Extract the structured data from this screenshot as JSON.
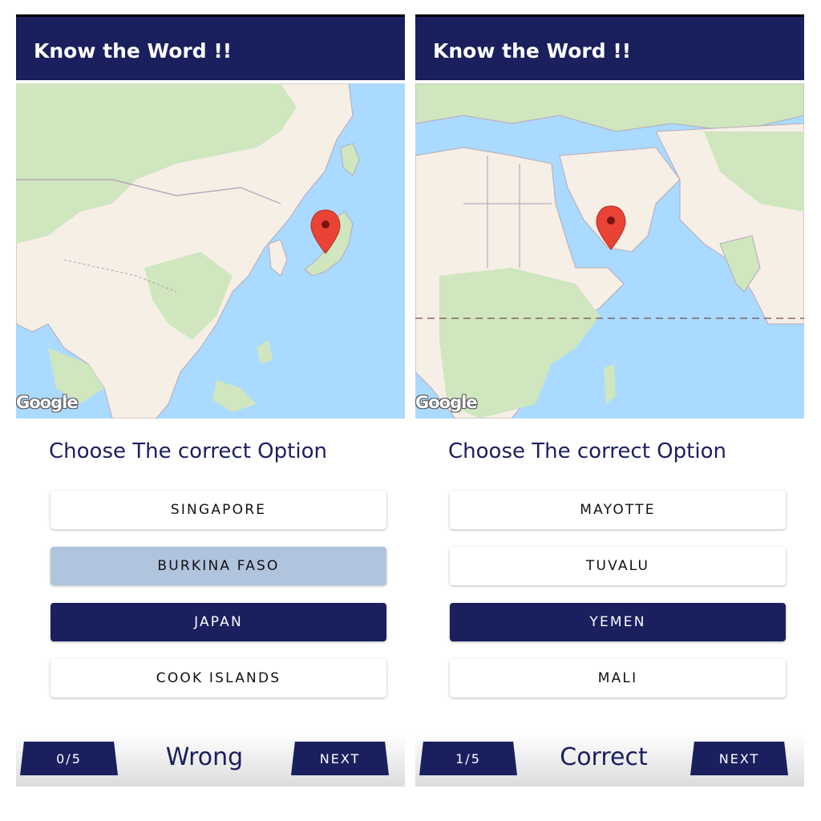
{
  "colors": {
    "primary": "#1a1f5e",
    "wrong_selected": "#b0c4de",
    "option_bg": "#ffffff",
    "map_water": "#aadaff",
    "map_land": "#f5efe6",
    "map_green": "#cfe6bf",
    "marker": "#ea4335"
  },
  "screens": [
    {
      "app_title": "Know the Word !!",
      "map_logo": "Google",
      "marker_icon": "map-pin-icon",
      "prompt": "Choose The correct Option",
      "options": [
        "SINGAPORE",
        "BURKINA FASO",
        "JAPAN",
        "COOK ISLANDS"
      ],
      "selected_option": "BURKINA FASO",
      "correct_option": "JAPAN",
      "score": "0/5",
      "result": "Wrong",
      "next_label": "NEXT"
    },
    {
      "app_title": "Know the Word !!",
      "map_logo": "Google",
      "marker_icon": "map-pin-icon",
      "prompt": "Choose The correct Option",
      "options": [
        "MAYOTTE",
        "TUVALU",
        "YEMEN",
        "MALI"
      ],
      "selected_option": "YEMEN",
      "correct_option": "YEMEN",
      "score": "1/5",
      "result": "Correct",
      "next_label": "NEXT"
    }
  ]
}
